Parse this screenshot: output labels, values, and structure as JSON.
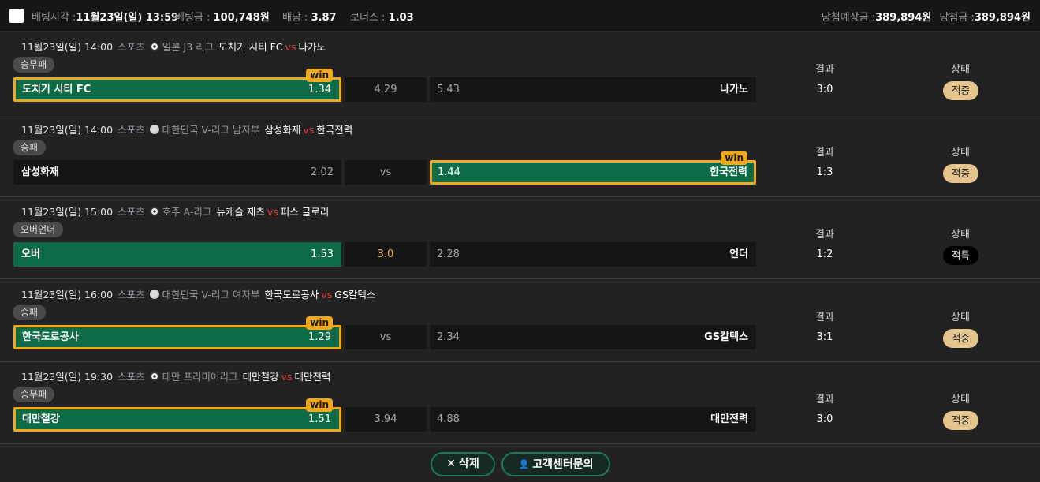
{
  "header": {
    "bet_time_label": "베팅시각 :",
    "bet_time": "11월23일(일) 13:59",
    "bet_amount_label": "베팅금 :",
    "bet_amount": "100,748원",
    "odds_label": "배당 :",
    "odds": "3.87",
    "bonus_label": "보너스 :",
    "bonus": "1.03",
    "expected_win_label": "당첨예상금 :",
    "expected_win": "389,894원",
    "win_amount_label": "당첨금 :",
    "win_amount": "389,894원"
  },
  "labels": {
    "result": "결과",
    "status": "상태",
    "win_badge": "win"
  },
  "bets": [
    {
      "datetime": "11월23일(일) 14:00",
      "sport": "스포츠",
      "league_icon": "soccer-ball-icon",
      "league": "일본 J3 리그",
      "home": "도치기 시티 FC",
      "vs": "vs",
      "away": "나가노",
      "market": "승무패",
      "home_name": "도치기 시티 FC",
      "home_odd": "1.34",
      "mid": "4.29",
      "away_odd": "5.43",
      "away_name": "나가노",
      "selected": "home",
      "result": "3:0",
      "status": "적중"
    },
    {
      "datetime": "11월23일(일) 14:00",
      "sport": "스포츠",
      "league_icon": "volleyball-icon",
      "league": "대한민국 V-리그 남자부",
      "home": "삼성화재",
      "vs": "vs",
      "away": "한국전력",
      "market": "승패",
      "home_name": "삼성화재",
      "home_odd": "2.02",
      "mid": "vs",
      "away_odd": "1.44",
      "away_name": "한국전력",
      "selected": "away",
      "result": "1:3",
      "status": "적중"
    },
    {
      "datetime": "11월23일(일) 15:00",
      "sport": "스포츠",
      "league_icon": "soccer-ball-icon",
      "league": "호주 A-리그",
      "home": "뉴캐슬 제츠",
      "vs": "vs",
      "away": "퍼스 글로리",
      "market": "오버언더",
      "home_name": "오버",
      "home_odd": "1.53",
      "mid": "3.0",
      "away_odd": "2.28",
      "away_name": "언더",
      "selected": "home",
      "result": "1:2",
      "status": "적특"
    },
    {
      "datetime": "11월23일(일) 16:00",
      "sport": "스포츠",
      "league_icon": "volleyball-icon",
      "league": "대한민국 V-리그 여자부",
      "home": "한국도로공사",
      "vs": "vs",
      "away": "GS칼텍스",
      "market": "승패",
      "home_name": "한국도로공사",
      "home_odd": "1.29",
      "mid": "vs",
      "away_odd": "2.34",
      "away_name": "GS칼텍스",
      "selected": "home",
      "result": "3:1",
      "status": "적중"
    },
    {
      "datetime": "11월23일(일) 19:30",
      "sport": "스포츠",
      "league_icon": "soccer-ball-icon",
      "league": "대만 프리미어리그",
      "home": "대만철강",
      "vs": "vs",
      "away": "대만전력",
      "market": "승무패",
      "home_name": "대만철강",
      "home_odd": "1.51",
      "mid": "3.94",
      "away_odd": "4.88",
      "away_name": "대만전력",
      "selected": "home",
      "result": "3:0",
      "status": "적중"
    }
  ],
  "footer": {
    "delete_label": "삭제",
    "delete_icon": "close-icon",
    "support_label": "고객센터문의",
    "support_icon": "person-icon"
  },
  "colors": {
    "selected_bg": "#0e6b48",
    "win_border": "#f0a91e",
    "hit_status": "#e4c58d",
    "vs_red": "#e23b3b"
  }
}
